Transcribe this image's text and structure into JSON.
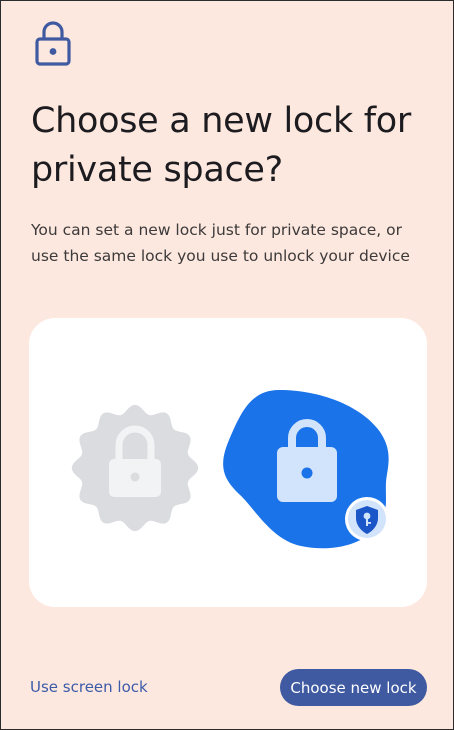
{
  "header": {
    "icon": "lock-icon",
    "title": "Choose a new lock for private space?",
    "subtitle": "You can set a new lock just for private space, or use the same lock you use to unlock your device"
  },
  "illustration": {
    "left_icon": "lock-icon",
    "right_icon": "lock-icon",
    "badge_icon": "key-shield-icon"
  },
  "actions": {
    "secondary_label": "Use screen lock",
    "primary_label": "Choose new lock"
  },
  "colors": {
    "background": "#fde8df",
    "accent": "#3f5aa1",
    "link": "#3b5ba9",
    "blob_blue": "#1a73e8",
    "inactive_gray": "#dadce0"
  }
}
